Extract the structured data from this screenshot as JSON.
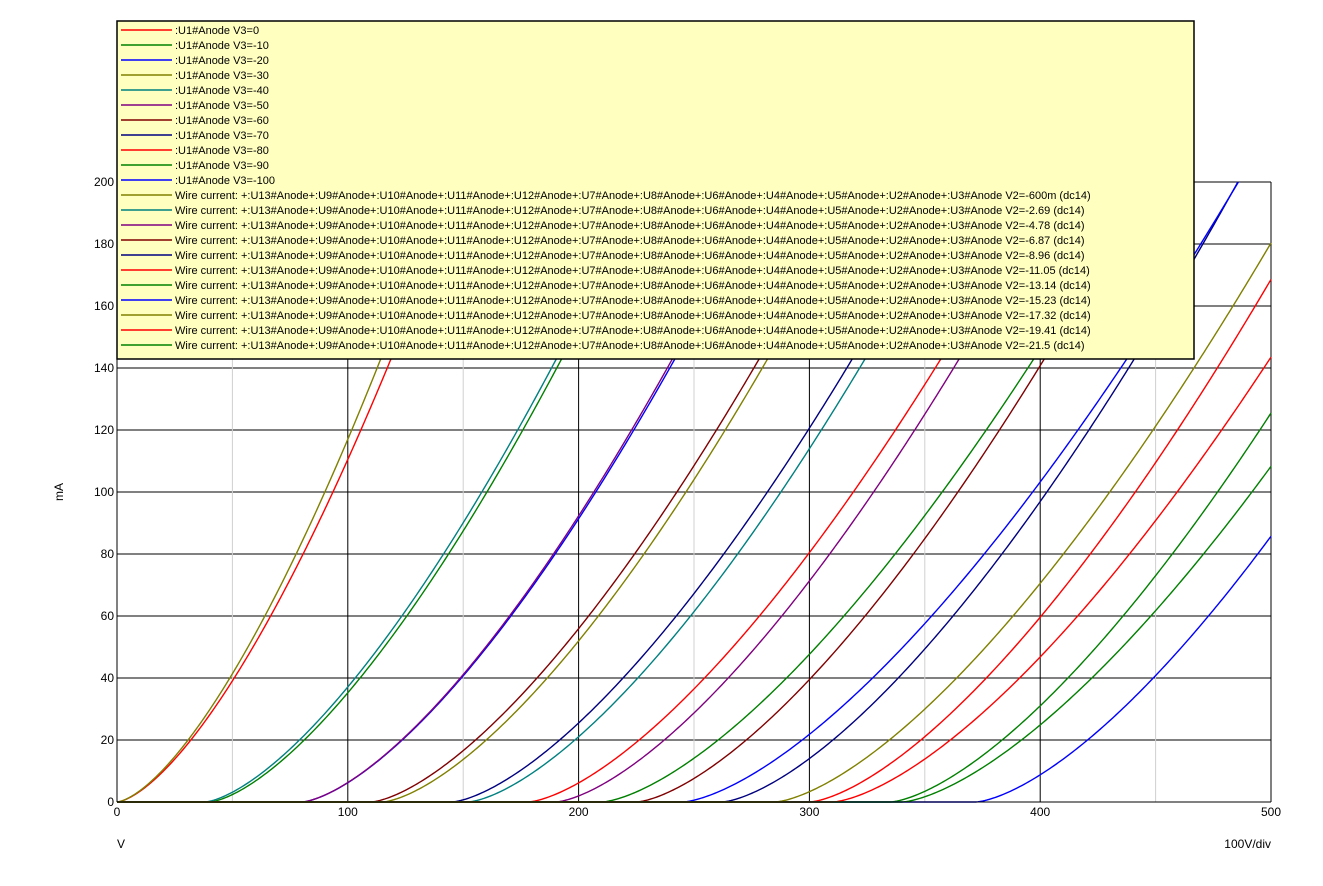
{
  "chart_data": {
    "type": "line",
    "title": "",
    "xlabel": "V",
    "ylabel": "mA",
    "x_scale_note": "100V/div",
    "xlim": [
      0,
      500
    ],
    "ylim": [
      0,
      200
    ],
    "x_ticks": [
      0,
      100,
      200,
      300,
      400,
      500
    ],
    "y_ticks": [
      0,
      20,
      40,
      60,
      80,
      100,
      120,
      140,
      160,
      180,
      200
    ],
    "grid": true,
    "legend_position": "top",
    "colors": {
      "red": "#ff0000",
      "green": "#008000",
      "blue": "#0000ff",
      "olive": "#808000",
      "teal": "#008080",
      "purple": "#800080",
      "maroon": "#800000",
      "navy": "#000080",
      "legend_bg": "#ffffc0",
      "grid": "#000000"
    },
    "series": [
      {
        "name": ":U1#Anode V3=0",
        "color": "red",
        "x0": 0,
        "k": 0.1105,
        "n": 1.5
      },
      {
        "name": ":U1#Anode V3=-10",
        "color": "green",
        "x0": 40,
        "k": 0.0758,
        "n": 1.5
      },
      {
        "name": ":U1#Anode V3=-20",
        "color": "blue",
        "x0": 80,
        "k": 0.0695,
        "n": 1.5
      },
      {
        "name": ":U1#Anode V3=-30",
        "color": "olive",
        "x0": 115,
        "k": 0.0663,
        "n": 1.5
      },
      {
        "name": ":U1#Anode V3=-40",
        "color": "teal",
        "x0": 152,
        "k": 0.0633,
        "n": 1.5
      },
      {
        "name": ":U1#Anode V3=-50",
        "color": "purple",
        "x0": 190,
        "k": 0.0618,
        "n": 1.5
      },
      {
        "name": ":U1#Anode V3=-60",
        "color": "maroon",
        "x0": 225,
        "k": 0.0608,
        "n": 1.5
      },
      {
        "name": ":U1#Anode V3=-70",
        "color": "navy",
        "x0": 262,
        "k": 0.0598,
        "n": 1.5
      },
      {
        "name": ":U1#Anode V3=-80",
        "color": "red",
        "x0": 300,
        "k": 0.0596,
        "n": 1.5
      },
      {
        "name": ":U1#Anode V3=-90",
        "color": "green",
        "x0": 335,
        "k": 0.0592,
        "n": 1.5
      },
      {
        "name": ":U1#Anode V3=-100",
        "color": "blue",
        "x0": 372,
        "k": 0.0592,
        "n": 1.5
      },
      {
        "name": "Wire current: +:U13#Anode+:U9#Anode+:U10#Anode+:U11#Anode+:U12#Anode+:U7#Anode+:U8#Anode+:U6#Anode+:U4#Anode+:U5#Anode+:U2#Anode+:U3#Anode V2=-600m (dc14)",
        "color": "olive",
        "x0": 0,
        "k": 0.117,
        "n": 1.5
      },
      {
        "name": "Wire current: +:U13#Anode+:U9#Anode+:U10#Anode+:U11#Anode+:U12#Anode+:U7#Anode+:U8#Anode+:U6#Anode+:U4#Anode+:U5#Anode+:U2#Anode+:U3#Anode V2=-2.69 (dc14)",
        "color": "teal",
        "x0": 38,
        "k": 0.076,
        "n": 1.5
      },
      {
        "name": "Wire current: +:U13#Anode+:U9#Anode+:U10#Anode+:U11#Anode+:U12#Anode+:U7#Anode+:U8#Anode+:U6#Anode+:U4#Anode+:U5#Anode+:U2#Anode+:U3#Anode V2=-4.78 (dc14)",
        "color": "purple",
        "x0": 80,
        "k": 0.0702,
        "n": 1.5
      },
      {
        "name": "Wire current: +:U13#Anode+:U9#Anode+:U10#Anode+:U11#Anode+:U12#Anode+:U7#Anode+:U8#Anode+:U6#Anode+:U4#Anode+:U5#Anode+:U2#Anode+:U3#Anode V2=-6.87 (dc14)",
        "color": "maroon",
        "x0": 110,
        "k": 0.0655,
        "n": 1.5
      },
      {
        "name": "Wire current: +:U13#Anode+:U9#Anode+:U10#Anode+:U11#Anode+:U12#Anode+:U7#Anode+:U8#Anode+:U6#Anode+:U4#Anode+:U5#Anode+:U2#Anode+:U3#Anode V2=-8.96 (dc14)",
        "color": "navy",
        "x0": 145,
        "k": 0.0625,
        "n": 1.5
      },
      {
        "name": "Wire current: +:U13#Anode+:U9#Anode+:U10#Anode+:U11#Anode+:U12#Anode+:U7#Anode+:U8#Anode+:U6#Anode+:U4#Anode+:U5#Anode+:U2#Anode+:U3#Anode V2=-11.05 (dc14)",
        "color": "red",
        "x0": 178,
        "k": 0.0597,
        "n": 1.5
      },
      {
        "name": "Wire current: +:U13#Anode+:U9#Anode+:U10#Anode+:U11#Anode+:U12#Anode+:U7#Anode+:U8#Anode+:U6#Anode+:U4#Anode+:U5#Anode+:U2#Anode+:U3#Anode V2=-13.14 (dc14)",
        "color": "green",
        "x0": 210,
        "k": 0.0558,
        "n": 1.5
      },
      {
        "name": "Wire current: +:U13#Anode+:U9#Anode+:U10#Anode+:U11#Anode+:U12#Anode+:U7#Anode+:U8#Anode+:U6#Anode+:U4#Anode+:U5#Anode+:U2#Anode+:U3#Anode V2=-15.23 (dc14)",
        "color": "blue",
        "x0": 245,
        "k": 0.0535,
        "n": 1.5
      },
      {
        "name": "Wire current: +:U13#Anode+:U9#Anode+:U10#Anode+:U11#Anode+:U12#Anode+:U7#Anode+:U8#Anode+:U6#Anode+:U4#Anode+:U5#Anode+:U2#Anode+:U3#Anode V2=-17.32 (dc14)",
        "color": "olive",
        "x0": 285,
        "k": 0.0572,
        "n": 1.5
      },
      {
        "name": "Wire current: +:U13#Anode+:U9#Anode+:U10#Anode+:U11#Anode+:U12#Anode+:U7#Anode+:U8#Anode+:U6#Anode+:U4#Anode+:U5#Anode+:U2#Anode+:U3#Anode V2=-19.41 (dc14)",
        "color": "red",
        "x0": 310,
        "k": 0.0548,
        "n": 1.5
      },
      {
        "name": "Wire current: +:U13#Anode+:U9#Anode+:U10#Anode+:U11#Anode+:U12#Anode+:U7#Anode+:U8#Anode+:U6#Anode+:U4#Anode+:U5#Anode+:U2#Anode+:U3#Anode V2=-21.5 (dc14)",
        "color": "green",
        "x0": 340,
        "k": 0.0535,
        "n": 1.5
      }
    ]
  }
}
